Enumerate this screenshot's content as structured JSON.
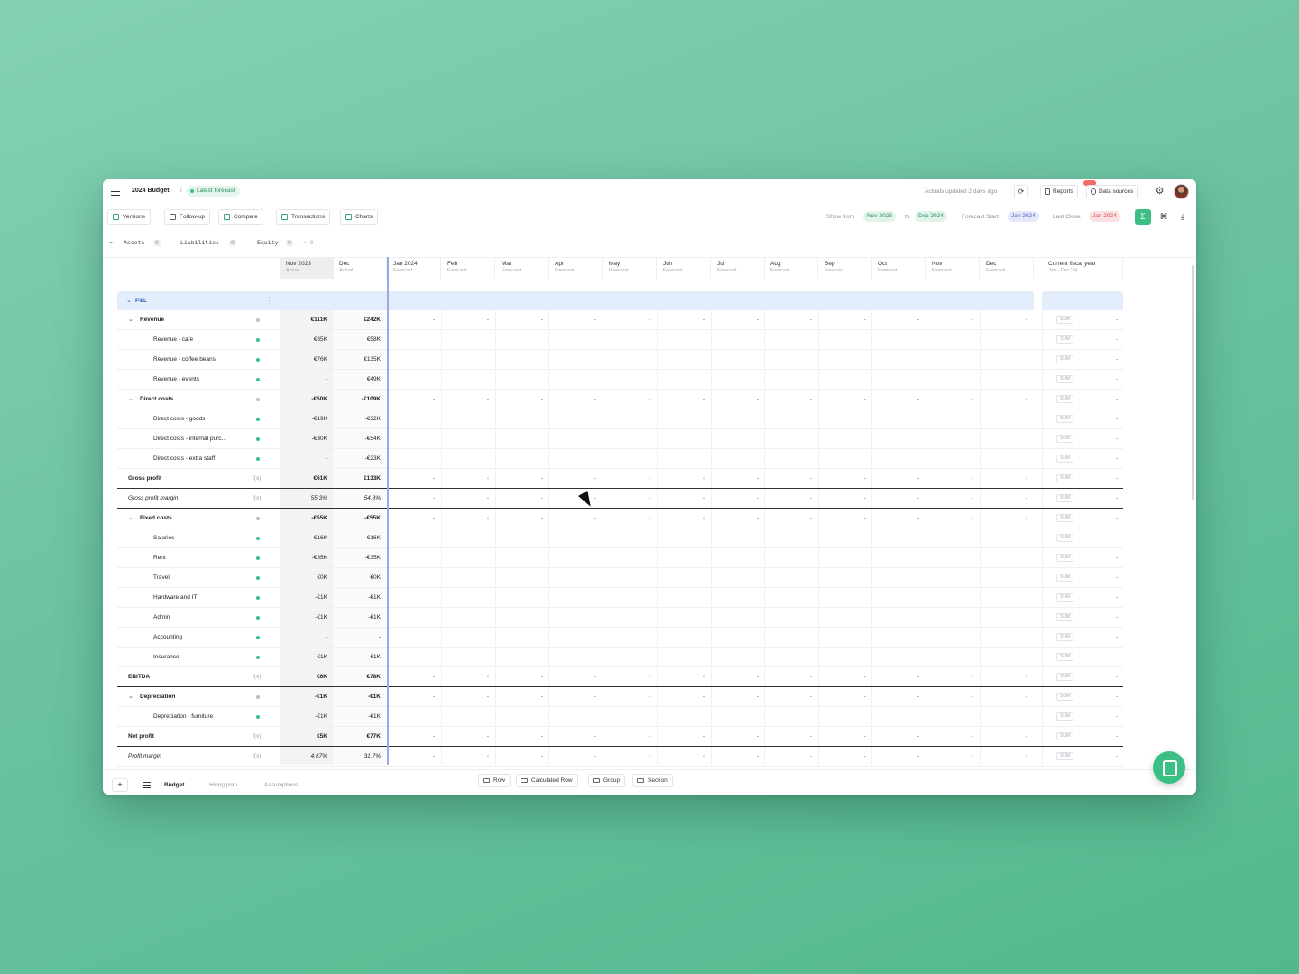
{
  "header": {
    "doc_title": "2024 Budget",
    "separator": "/",
    "forecast_label": "Latest forecast",
    "actuals_updated": "Actuals updated 2 days ago",
    "reports_label": "Reports",
    "data_sources_label": "Data sources"
  },
  "toolbar": {
    "versions": "Versions",
    "follow_up": "Follow-up",
    "compare": "Compare",
    "transactions": "Transactions",
    "charts": "Charts",
    "show_from_label": "Show from",
    "show_from": "Nov 2023",
    "to_label": "to",
    "show_to": "Dec 2024",
    "forecast_start_label": "Forecast Start",
    "forecast_start": "Jan 2024",
    "last_close_label": "Last Close",
    "last_close": "Jan 2024"
  },
  "balance": {
    "lead": "=",
    "assets": "Assets",
    "assets_count": "0",
    "minus1": "-",
    "liabilities": "Liabilities",
    "liabilities_count": "0",
    "minus2": "-",
    "equity": "Equity",
    "equity_count": "0",
    "result": "= 0"
  },
  "columns": [
    {
      "month": "Nov 2023",
      "type": "Actual"
    },
    {
      "month": "Dec",
      "type": "Actual"
    },
    {
      "month": "Jan 2024",
      "type": "Forecast"
    },
    {
      "month": "Feb",
      "type": "Forecast"
    },
    {
      "month": "Mar",
      "type": "Forecast"
    },
    {
      "month": "Apr",
      "type": "Forecast"
    },
    {
      "month": "May",
      "type": "Forecast"
    },
    {
      "month": "Jun",
      "type": "Forecast"
    },
    {
      "month": "Jul",
      "type": "Forecast"
    },
    {
      "month": "Aug",
      "type": "Forecast"
    },
    {
      "month": "Sep",
      "type": "Forecast"
    },
    {
      "month": "Oct",
      "type": "Forecast"
    },
    {
      "month": "Nov",
      "type": "Forecast"
    },
    {
      "month": "Dec",
      "type": "Forecast"
    }
  ],
  "fiscal": {
    "title": "Current fiscal year",
    "range": "Jan - Dec '24"
  },
  "section": {
    "label": "P&L"
  },
  "rows": [
    {
      "label": "Revenue",
      "kind": "group",
      "nov": "€111K",
      "dec": "€242K",
      "fc": "-",
      "sum": "SUM",
      "sum_val": "-"
    },
    {
      "label": "Revenue - cafe",
      "kind": "item",
      "nov": "€35K",
      "dec": "€58K",
      "fc": "",
      "sum": "SUM",
      "sum_val": "-"
    },
    {
      "label": "Revenue - coffee beans",
      "kind": "item",
      "nov": "€76K",
      "dec": "€135K",
      "fc": "",
      "sum": "SUM",
      "sum_val": "-"
    },
    {
      "label": "Revenue - events",
      "kind": "item",
      "nov": "-",
      "dec": "€49K",
      "fc": "",
      "sum": "SUM",
      "sum_val": "-"
    },
    {
      "label": "Direct costs",
      "kind": "group",
      "nov": "-€50K",
      "dec": "-€109K",
      "fc": "-",
      "sum": "SUM",
      "sum_val": "-"
    },
    {
      "label": "Direct costs - goods",
      "kind": "item",
      "nov": "-€19K",
      "dec": "-€32K",
      "fc": "",
      "sum": "SUM",
      "sum_val": "-"
    },
    {
      "label": "Direct costs - internal purc...",
      "kind": "item",
      "nov": "-€30K",
      "dec": "-€54K",
      "fc": "",
      "sum": "SUM",
      "sum_val": "-"
    },
    {
      "label": "Direct costs - extra staff",
      "kind": "item",
      "nov": "-",
      "dec": "-€23K",
      "fc": "",
      "sum": "SUM",
      "sum_val": "-"
    },
    {
      "label": "Gross profit",
      "kind": "calc",
      "nov": "€61K",
      "dec": "€133K",
      "fc": "-",
      "sum": "SUM",
      "sum_val": "-"
    },
    {
      "label": "Gross profit margin",
      "kind": "calc-italic",
      "nov": "55.3%",
      "dec": "54.8%",
      "fc": "-",
      "sum": "SUM",
      "sum_val": "-"
    },
    {
      "label": "Fixed costs",
      "kind": "group",
      "nov": "-€55K",
      "dec": "-€55K",
      "fc": "-",
      "sum": "SUM",
      "sum_val": "-"
    },
    {
      "label": "Salaries",
      "kind": "item",
      "nov": "-€16K",
      "dec": "-€16K",
      "fc": "",
      "sum": "SUM",
      "sum_val": "-"
    },
    {
      "label": "Rent",
      "kind": "item",
      "nov": "-€35K",
      "dec": "-€35K",
      "fc": "",
      "sum": "SUM",
      "sum_val": "-"
    },
    {
      "label": "Travel",
      "kind": "item",
      "nov": "€0K",
      "dec": "€0K",
      "fc": "",
      "sum": "SUM",
      "sum_val": "-"
    },
    {
      "label": "Hardware and IT",
      "kind": "item",
      "nov": "-€1K",
      "dec": "-€1K",
      "fc": "",
      "sum": "SUM",
      "sum_val": "-"
    },
    {
      "label": "Admin",
      "kind": "item",
      "nov": "-€1K",
      "dec": "-€1K",
      "fc": "",
      "sum": "SUM",
      "sum_val": "-"
    },
    {
      "label": "Accounting",
      "kind": "item",
      "nov": "-",
      "dec": "-",
      "fc": "",
      "sum": "SUM",
      "sum_val": "-"
    },
    {
      "label": "Insurance",
      "kind": "item",
      "nov": "-€1K",
      "dec": "-€1K",
      "fc": "",
      "sum": "SUM",
      "sum_val": "-"
    },
    {
      "label": "EBITDA",
      "kind": "calc",
      "nov": "€6K",
      "dec": "€78K",
      "fc": "-",
      "sum": "SUM",
      "sum_val": "-"
    },
    {
      "label": "Depreciation",
      "kind": "group",
      "nov": "-€1K",
      "dec": "-€1K",
      "fc": "-",
      "sum": "SUM",
      "sum_val": "-"
    },
    {
      "label": "Depreciation - furniture",
      "kind": "item",
      "nov": "-€1K",
      "dec": "-€1K",
      "fc": "",
      "sum": "SUM",
      "sum_val": "-"
    },
    {
      "label": "Net profit",
      "kind": "calc",
      "nov": "€5K",
      "dec": "€77K",
      "fc": "-",
      "sum": "SUM",
      "sum_val": "-"
    },
    {
      "label": "Profit margin",
      "kind": "calc-italic",
      "nov": "4.67%",
      "dec": "31.7%",
      "fc": "-",
      "sum": "SUM",
      "sum_val": "-"
    }
  ],
  "fx_label": "f(x)",
  "bottom": {
    "add": "+",
    "tabs": [
      "Budget",
      "Hiring plan",
      "Assumptions"
    ],
    "add_row": "Row",
    "add_calc_row": "Calculated Row",
    "add_group": "Group",
    "add_section": "Section"
  },
  "colors": {
    "accent_green": "#3cbf84",
    "section_blue": "#e3edfb",
    "forecast_divider": "#9aa8e6"
  }
}
